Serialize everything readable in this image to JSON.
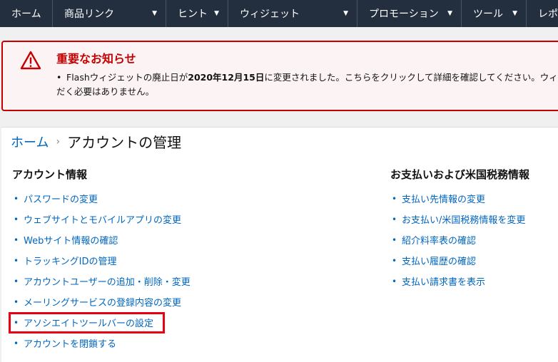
{
  "nav": {
    "home": "ホーム",
    "links": "商品リンク",
    "hints": "ヒント",
    "widgets": "ウィジェット",
    "promotions": "プロモーション",
    "tools": "ツール",
    "reports": "レポ"
  },
  "alert": {
    "title": "重要なお知らせ",
    "bullet": "•",
    "line1_pre": "Flashウィジェットの廃止日が",
    "line1_date": "2020年12月15日",
    "line1_post": "に変更されました。こちらをクリックして詳細を確認してください。ウィ",
    "line2": "だく必要はありません。"
  },
  "breadcrumb": {
    "home": "ホーム",
    "separator": "›",
    "current": "アカウントの管理"
  },
  "account": {
    "title": "アカウント情報",
    "items": [
      "パスワードの変更",
      "ウェブサイトとモバイルアプリの変更",
      "Webサイト情報の確認",
      "トラッキングIDの管理",
      "アカウントユーザーの追加・削除・変更",
      "メーリングサービスの登録内容の変更",
      "アソシエイトツールバーの設定",
      "アカウントを閉鎖する"
    ]
  },
  "payment": {
    "title": "お支払いおよび米国税務情報",
    "items": [
      "支払い先情報の変更",
      "お支払い/米国税務情報を変更",
      "紹介料率表の確認",
      "支払い履歴の確認",
      "支払い請求書を表示"
    ]
  },
  "colors": {
    "nav_bg": "#232f3e",
    "alert_red": "#c40000",
    "link_blue": "#0066c0",
    "highlight_red": "#e60012"
  }
}
